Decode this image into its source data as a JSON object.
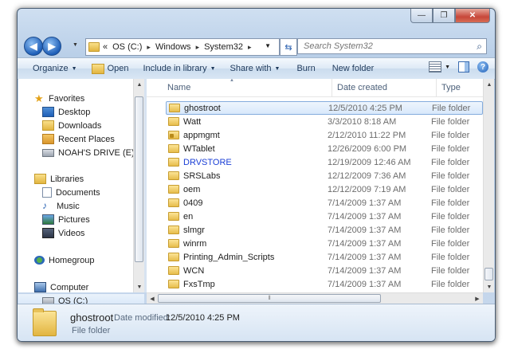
{
  "window": {
    "caption_buttons": {
      "minimize": "—",
      "maximize": "❐",
      "close": "✕"
    }
  },
  "address_bar": {
    "overflow": "«",
    "segments": [
      "OS (C:)",
      "Windows",
      "System32"
    ],
    "separator": "▸"
  },
  "search": {
    "placeholder": "Search System32"
  },
  "toolbar": {
    "organize": "Organize",
    "open": "Open",
    "include_in_library": "Include in library",
    "share_with": "Share with",
    "burn": "Burn",
    "new_folder": "New folder"
  },
  "nav_pane": {
    "favorites": {
      "label": "Favorites",
      "items": [
        "Desktop",
        "Downloads",
        "Recent Places",
        "NOAH'S DRIVE (E)"
      ]
    },
    "libraries": {
      "label": "Libraries",
      "items": [
        "Documents",
        "Music",
        "Pictures",
        "Videos"
      ]
    },
    "homegroup": {
      "label": "Homegroup"
    },
    "computer": {
      "label": "Computer",
      "items": [
        "OS (C:)"
      ]
    }
  },
  "columns": {
    "name": "Name",
    "date_created": "Date created",
    "type": "Type"
  },
  "files": [
    {
      "name": "ghostroot",
      "date": "12/5/2010 4:25 PM",
      "type": "File folder",
      "selected": true,
      "locked": false,
      "blue": false
    },
    {
      "name": "Watt",
      "date": "3/3/2010 8:18 AM",
      "type": "File folder",
      "selected": false,
      "locked": false,
      "blue": false
    },
    {
      "name": "appmgmt",
      "date": "2/12/2010 11:22 PM",
      "type": "File folder",
      "selected": false,
      "locked": true,
      "blue": false
    },
    {
      "name": "WTablet",
      "date": "12/26/2009 6:00 PM",
      "type": "File folder",
      "selected": false,
      "locked": false,
      "blue": false
    },
    {
      "name": "DRVSTORE",
      "date": "12/19/2009 12:46 AM",
      "type": "File folder",
      "selected": false,
      "locked": false,
      "blue": true
    },
    {
      "name": "SRSLabs",
      "date": "12/12/2009 7:36 AM",
      "type": "File folder",
      "selected": false,
      "locked": false,
      "blue": false
    },
    {
      "name": "oem",
      "date": "12/12/2009 7:19 AM",
      "type": "File folder",
      "selected": false,
      "locked": false,
      "blue": false
    },
    {
      "name": "0409",
      "date": "7/14/2009 1:37 AM",
      "type": "File folder",
      "selected": false,
      "locked": false,
      "blue": false
    },
    {
      "name": "en",
      "date": "7/14/2009 1:37 AM",
      "type": "File folder",
      "selected": false,
      "locked": false,
      "blue": false
    },
    {
      "name": "slmgr",
      "date": "7/14/2009 1:37 AM",
      "type": "File folder",
      "selected": false,
      "locked": false,
      "blue": false
    },
    {
      "name": "winrm",
      "date": "7/14/2009 1:37 AM",
      "type": "File folder",
      "selected": false,
      "locked": false,
      "blue": false
    },
    {
      "name": "Printing_Admin_Scripts",
      "date": "7/14/2009 1:37 AM",
      "type": "File folder",
      "selected": false,
      "locked": false,
      "blue": false
    },
    {
      "name": "WCN",
      "date": "7/14/2009 1:37 AM",
      "type": "File folder",
      "selected": false,
      "locked": false,
      "blue": false
    },
    {
      "name": "FxsTmp",
      "date": "7/14/2009 1:37 AM",
      "type": "File folder",
      "selected": false,
      "locked": false,
      "blue": false
    }
  ],
  "details": {
    "name": "ghostroot",
    "modified_label": "Date modified:",
    "modified_value": "12/5/2010 4:25 PM",
    "type": "File folder"
  },
  "colors": {
    "selection": "#d8e8fb",
    "link_blue": "#1a3ed6",
    "toolbar_text": "#1e395b"
  }
}
